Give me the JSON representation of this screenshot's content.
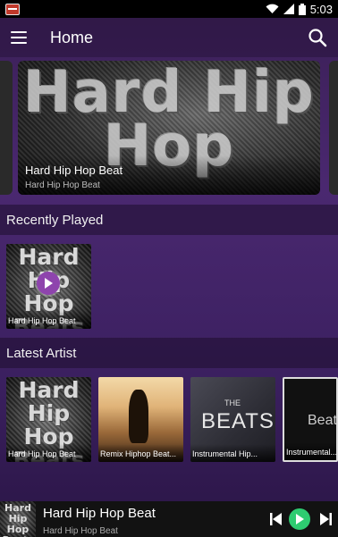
{
  "status_bar": {
    "time": "5:03"
  },
  "app_bar": {
    "title": "Home"
  },
  "banner": {
    "art_text": "Hard Hip Hop",
    "title": "Hard Hip Hop Beat",
    "subtitle": "Hard Hip Hop Beat"
  },
  "recently_played": {
    "header": "Recently Played",
    "items": [
      {
        "art": "Hard Hip Hop Beats",
        "label": "Hard Hip Hop Beat"
      }
    ]
  },
  "latest_artist": {
    "header": "Latest Artist",
    "items": [
      {
        "art": "Hard Hip Hop Beats",
        "label": "Hard Hip Hop Beat"
      },
      {
        "label": "Remix Hiphop Beat..."
      },
      {
        "art_small": "THE",
        "art_big": "BEATS",
        "label": "Instrumental Hip..."
      },
      {
        "art": "Beat",
        "label": "Instrumental..."
      }
    ]
  },
  "player": {
    "art": "Hard Hip Hop Beats",
    "title": "Hard Hip Hop Beat",
    "subtitle": "Hard Hip Hop Beat"
  },
  "colors": {
    "accent_purple": "#8e44ad",
    "play_green": "#2ecc71",
    "background": "#4a2870"
  },
  "icons": [
    "menu-icon",
    "search-icon",
    "play-icon",
    "previous-icon",
    "next-icon",
    "wifi-icon",
    "signal-icon",
    "battery-icon",
    "notification-icon"
  ]
}
